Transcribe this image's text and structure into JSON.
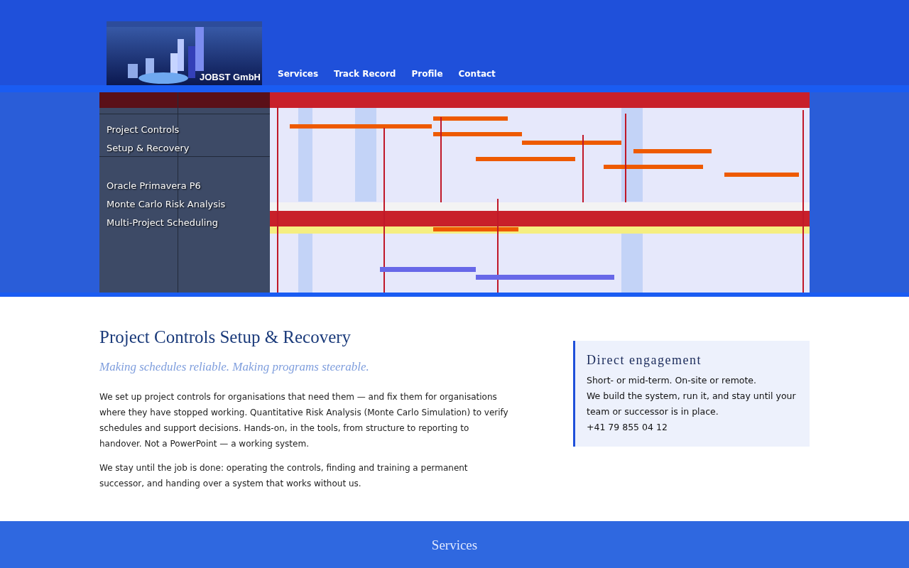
{
  "logo": {
    "text": "JOBST GmbH"
  },
  "nav": [
    {
      "label": "Services"
    },
    {
      "label": "Track Record"
    },
    {
      "label": "Profile"
    },
    {
      "label": "Contact"
    }
  ],
  "banner": {
    "groups": [
      [
        "Project Controls",
        "Setup & Recovery"
      ],
      [
        "Oracle Primavera P6",
        "Monte Carlo Risk Analysis",
        "Multi-Project Scheduling"
      ]
    ]
  },
  "main": {
    "title": "Project Controls Setup & Recovery",
    "tagline": "Making schedules reliable. Making programs steerable.",
    "paragraphs": [
      "We set up project controls for organisations that need them — and fix them for organisations where they have stopped working. Quantitative Risk Analysis (Monte Carlo Simulation) to verify schedules and support decisions. Hands-on, in the tools, from structure to reporting to handover. Not a PowerPoint — a working system.",
      "We stay until the job is done: operating the controls, finding and training a permanent successor, and handing over a system that works without us."
    ]
  },
  "aside": {
    "title": "Direct engagement",
    "lines": [
      "Short- or mid-term. On-site or remote.",
      "We build the system, run it, and stay until your team or successor is in place.",
      "+41 79 855 04 12"
    ]
  },
  "footer": {
    "heading": "Services"
  }
}
